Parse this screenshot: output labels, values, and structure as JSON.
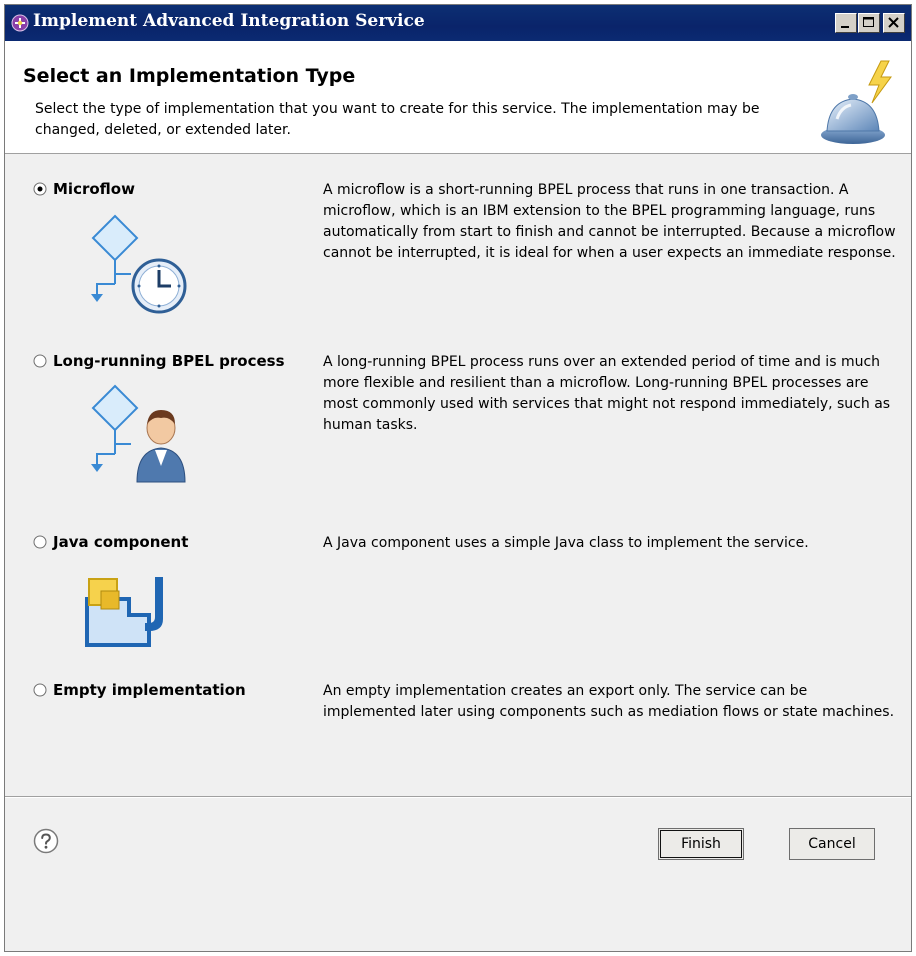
{
  "window": {
    "title": "Implement Advanced Integration Service",
    "controls": [
      "minimize-icon",
      "maximize-icon",
      "close-icon"
    ]
  },
  "header": {
    "title": "Select an Implementation Type",
    "description": "Select the type of implementation that you want to create for this service. The implementation may be changed, deleted, or extended later.",
    "icon": "wizard-bell-lightning-icon"
  },
  "options": [
    {
      "label": "Microflow",
      "selected": true,
      "icon": "microflow-clock-icon",
      "description": "A microflow is a short-running BPEL process that runs in one transaction. A microflow, which is an IBM extension to the BPEL programming language, runs automatically from start to finish and cannot be interrupted. Because a microflow cannot be interrupted, it is ideal for when a user expects an immediate response."
    },
    {
      "label": "Long-running BPEL process",
      "selected": false,
      "icon": "bpel-process-person-icon",
      "description": "A long-running BPEL process runs over an extended period of time and is much more flexible and resilient than a microflow. Long-running BPEL processes are most commonly used with services that might not respond immediately, such as human tasks."
    },
    {
      "label": "Java component",
      "selected": false,
      "icon": "java-component-icon",
      "description": "A Java component uses a simple Java class to implement the service."
    },
    {
      "label": "Empty implementation",
      "selected": false,
      "icon": "",
      "description": "An empty implementation creates an export only. The service can be implemented later using components such as mediation flows or state machines."
    }
  ],
  "footer": {
    "help_icon": "help-icon",
    "finish_label": "Finish",
    "cancel_label": "Cancel"
  }
}
